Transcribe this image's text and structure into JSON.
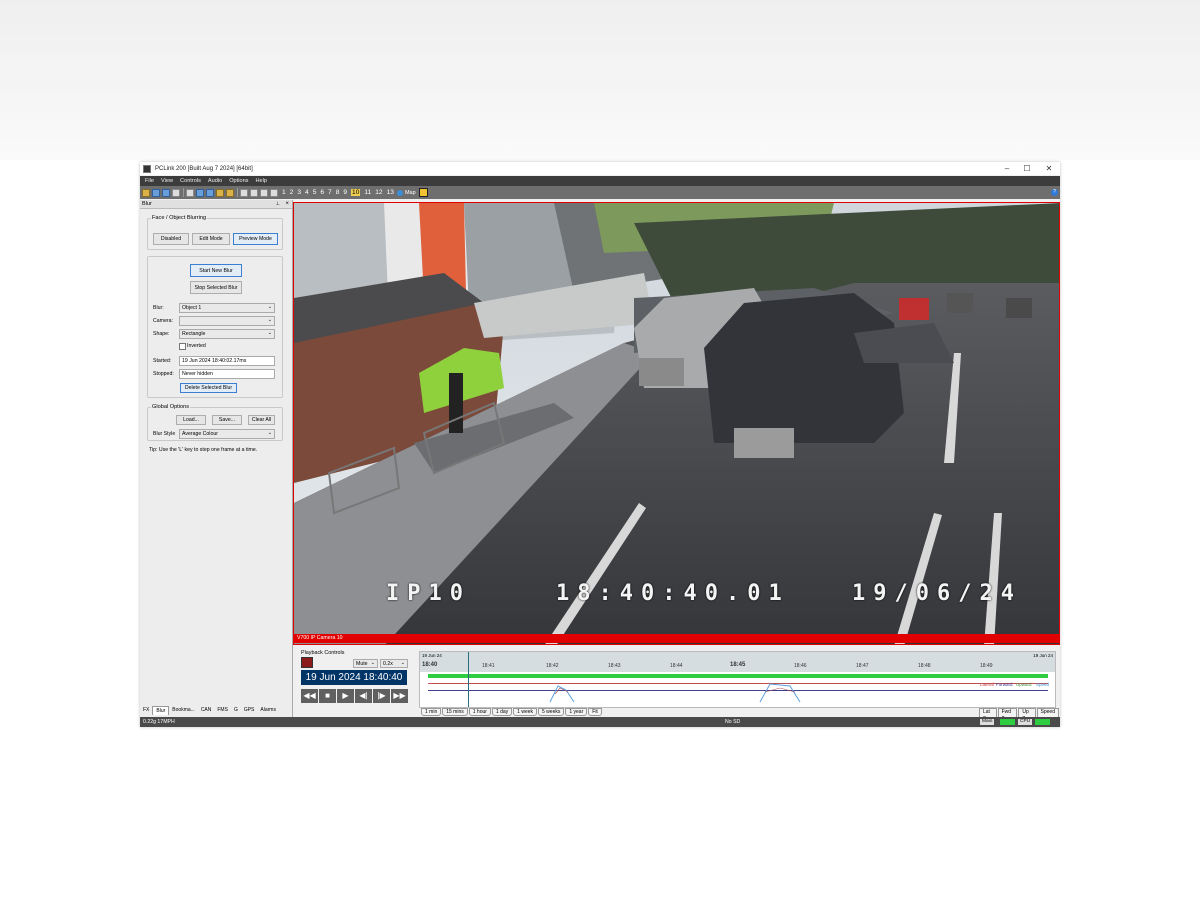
{
  "window": {
    "title": "PCLink 200 [Built Aug  7 2024] [64bit]"
  },
  "menu": [
    "File",
    "View",
    "Controls",
    "Audio",
    "Options",
    "Help"
  ],
  "toolbar": {
    "cameras": [
      "1",
      "2",
      "3",
      "4",
      "5",
      "6",
      "7",
      "8",
      "9",
      "10",
      "11",
      "12",
      "13"
    ],
    "active_camera": "10",
    "map_label": "Map"
  },
  "left_panel": {
    "header": "Blur",
    "blur_group": {
      "title": "Face / Object Blurring",
      "mode_buttons": [
        "Disabled",
        "Edit Mode",
        "Preview Mode"
      ],
      "active_mode": "Preview Mode"
    },
    "actions": {
      "start": "Start New Blur",
      "stop": "Stop Selected Blur"
    },
    "fields": {
      "blur_label": "Blur:",
      "blur_value": "Object 1",
      "camera_label": "Camera:",
      "camera_value": "",
      "shape_label": "Shape:",
      "shape_value": "Rectangle",
      "inverted_label": "Inverted",
      "started_label": "Started:",
      "started_value": "19 Jun 2024  18:40:02.17ms",
      "stopped_label": "Stopped:",
      "stopped_value": "Never hidden",
      "delete": "Delete Selected Blur"
    },
    "global": {
      "title": "Global Options",
      "load": "Load...",
      "save": "Save...",
      "clear": "Clear All",
      "style_label": "Blur Style",
      "style_value": "Average Colour"
    },
    "tip": "Tip: Use the 'L' key to step one frame at a time.",
    "tabs": [
      "FX",
      "Blur",
      "Bookma...",
      "CAN",
      "FMS",
      "G",
      "GPS",
      "Alarms"
    ],
    "active_tab": "Blur"
  },
  "video": {
    "camera_label": "V700 IP Camera 10",
    "osd_camera": "IP10",
    "osd_time": "18:40:40.01",
    "osd_date": "19/06/24"
  },
  "playback": {
    "title": "Playback Controls",
    "mute": "Mute",
    "speed": "0.2x",
    "datetime": "19 Jun 2024  18:40:40",
    "controls": [
      "◀◀",
      "■",
      "▶",
      "◀|",
      "|▶",
      "▶▶"
    ],
    "timeline_start_date": "19 Jun 24",
    "timeline_end_date": "19 Jun 24",
    "ticks": [
      "18:40",
      "18:41",
      "18:42",
      "18:43",
      "18:44",
      "18:45",
      "18:46",
      "18:47",
      "18:48",
      "18:49"
    ],
    "legend": [
      "Lateral",
      "Forward",
      "Upward",
      "Speed"
    ],
    "range_tabs": [
      "1 min",
      "15 mins",
      "1 hour",
      "1 day",
      "1 week",
      "5 weeks",
      "1 year",
      "Fit"
    ],
    "graph_tabs": [
      "Lat g",
      "Fwd g",
      "Up g",
      "Speed"
    ]
  },
  "status": {
    "left": "0.22g   17MPH",
    "center": "No SD",
    "main": "Main",
    "cpu": "CPU"
  }
}
